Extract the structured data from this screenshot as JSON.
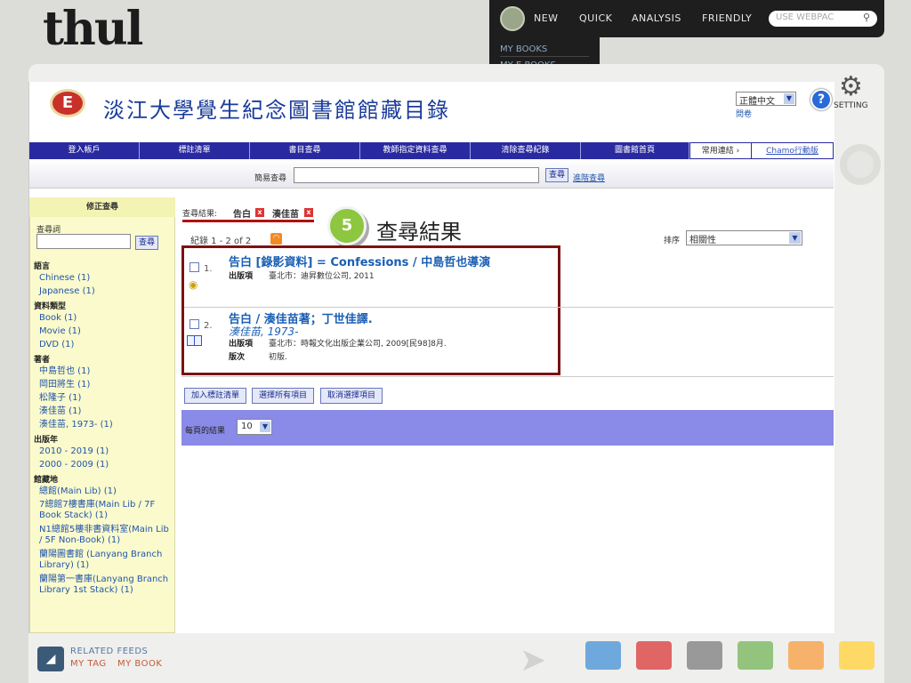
{
  "site": {
    "logo_text": "thul"
  },
  "top_nav": {
    "items": [
      "NEW",
      "QUICK",
      "ANALYSIS",
      "FRIENDLY"
    ],
    "webpac_placeholder": "USE WEBPAC",
    "dropdown": [
      "MY BOOKS",
      "MY E-BOOKS"
    ]
  },
  "setting": {
    "label": "SETTING"
  },
  "header": {
    "emblem_letter": "E",
    "title": "淡江大學覺生紀念圖書館館藏目錄",
    "language": "正體中文",
    "survey_link": "問卷",
    "help": "?"
  },
  "menu": {
    "items": [
      "登入帳戶",
      "標註清單",
      "書目查尋",
      "教師指定資料查尋",
      "清除查尋紀錄",
      "圖書館首頁"
    ],
    "common_links": "常用連結 ›",
    "chamo": "Chamo行動版"
  },
  "simple_search": {
    "label": "簡易查尋",
    "button": "查尋",
    "advanced": "進階查尋",
    "value": ""
  },
  "sidebar": {
    "heading": "修正查尋",
    "keyword_label": "查尋詞",
    "button": "查尋",
    "facets": [
      {
        "heading": "語言",
        "items": [
          "Chinese (1)",
          "Japanese (1)"
        ]
      },
      {
        "heading": "資料類型",
        "items": [
          "Book (1)",
          "Movie (1)",
          "DVD (1)"
        ]
      },
      {
        "heading": "著者",
        "items": [
          "中島哲也 (1)",
          "岡田將生 (1)",
          "松隆子 (1)",
          "湊佳苗 (1)",
          "湊佳苗, 1973- (1)"
        ]
      },
      {
        "heading": "出版年",
        "items": [
          "2010 - 2019 (1)",
          "2000 - 2009 (1)"
        ]
      },
      {
        "heading": "館藏地",
        "items": [
          "總館(Main Lib) (1)",
          "7總館7樓書庫(Main Lib / 7F Book Stack) (1)",
          "N1總館5樓非書資料室(Main Lib / 5F Non-Book) (1)",
          "蘭陽圖書館 (Lanyang Branch Library) (1)",
          "蘭陽第一書庫(Lanyang Branch Library 1st Stack) (1)"
        ]
      }
    ]
  },
  "results": {
    "label": "查尋結果:",
    "tags": [
      "告白",
      "湊佳苗"
    ],
    "remove_icon": "x",
    "step_number": "5",
    "step_label": "查尋結果",
    "record_count": "紀錄 1 - 2 of 2",
    "sort_label": "排序",
    "sort_value": "相關性",
    "pub_label": "出版項",
    "edition_label": "版次",
    "records": [
      {
        "num": "1.",
        "title": "告白 [錄影資料] = Confessions / 中島哲也導演",
        "publication": "臺北市：迪昇數位公司, 2011"
      },
      {
        "num": "2.",
        "title": "告白 / 湊佳苗著；丁世佳譯.",
        "author": "湊佳苗, 1973-",
        "publication": "臺北市：時報文化出版企業公司, 2009[民98]8月.",
        "edition": "初版."
      }
    ],
    "buttons": [
      "加入標註清單",
      "選擇所有項目",
      "取消選擇項目"
    ],
    "per_page_label": "每頁的結果",
    "per_page_value": "10"
  },
  "footer": {
    "related_feeds": "RELATED FEEDS",
    "my_tag": "MY TAG",
    "my_book": "MY BOOK",
    "swatches": [
      "#6fa8dc",
      "#e06666",
      "#999999",
      "#93c47d",
      "#f6b26b",
      "#ffd966"
    ]
  },
  "colors": {
    "menu_blue": "#2a2aa0",
    "sidebar_yellow": "#fafacc",
    "result_border": "#7a1212",
    "perpage_bar": "#8a8ae8",
    "step_green": "#8dc63f"
  }
}
